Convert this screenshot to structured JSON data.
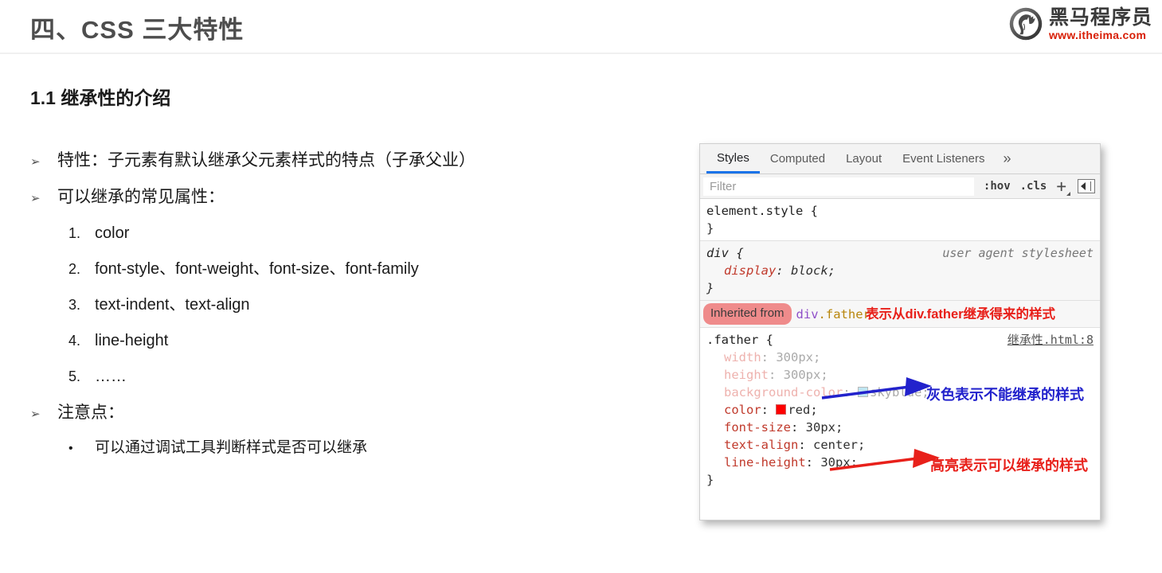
{
  "header": {
    "title": "四、CSS 三大特性",
    "logo": {
      "icon": "horse-head-circle-logo",
      "brand_cn": "黑马程序员",
      "url": "www.itheima.com",
      "url_color": "#d81e06"
    }
  },
  "section": {
    "heading": "1.1 继承性的介绍"
  },
  "bullets": [
    {
      "marker": "➢",
      "text": "特性：子元素有默认继承父元素样式的特点（子承父业）"
    },
    {
      "marker": "➢",
      "text": "可以继承的常见属性："
    }
  ],
  "numbered": [
    {
      "marker": "1.",
      "text": "color"
    },
    {
      "marker": "2.",
      "text": "font-style、font-weight、font-size、font-family"
    },
    {
      "marker": "3.",
      "text": "text-indent、text-align"
    },
    {
      "marker": "4.",
      "text": "line-height"
    },
    {
      "marker": "5.",
      "text": "……"
    }
  ],
  "note": {
    "marker": "➢",
    "title": "注意点：",
    "sub_marker": "•",
    "sub_text": "可以通过调试工具判断样式是否可以继承"
  },
  "devtools": {
    "tabs": [
      {
        "label": "Styles",
        "active": true
      },
      {
        "label": "Computed",
        "active": false
      },
      {
        "label": "Layout",
        "active": false
      },
      {
        "label": "Event Listeners",
        "active": false
      }
    ],
    "more_tabs_icon": "»",
    "filter": {
      "placeholder": "Filter",
      "value": ""
    },
    "toolbar": {
      "hov": ":hov",
      "cls": ".cls",
      "new_rule_icon": "plus-icon",
      "sidebar_toggle_icon": "panel-toggle-icon"
    },
    "rules": [
      {
        "selector": "element.style {",
        "origin": "",
        "close": "}",
        "declarations": []
      },
      {
        "selector": "div {",
        "origin": "user agent stylesheet",
        "close": "}",
        "declarations": [
          {
            "prop": "display",
            "value": "block;",
            "dim": false,
            "swatch": null
          }
        ]
      }
    ],
    "inherited": {
      "pill": "Inherited from",
      "tag": "div",
      "cls": ".father"
    },
    "father_rule": {
      "selector": ".father {",
      "source": "继承性.html:8",
      "close": "}",
      "declarations": [
        {
          "prop": "width",
          "value": "300px;",
          "dim": true,
          "swatch": null
        },
        {
          "prop": "height",
          "value": "300px;",
          "dim": true,
          "swatch": null
        },
        {
          "prop": "background-color",
          "value": "skyblue;",
          "dim": true,
          "swatch": "#bfe6f2"
        },
        {
          "prop": "color",
          "value": "red;",
          "dim": false,
          "swatch": "#ff0000"
        },
        {
          "prop": "font-size",
          "value": "30px;",
          "dim": false,
          "swatch": null
        },
        {
          "prop": "text-align",
          "value": "center;",
          "dim": false,
          "swatch": null
        },
        {
          "prop": "line-height",
          "value": "30px;",
          "dim": false,
          "swatch": null
        }
      ]
    }
  },
  "annotations": [
    {
      "id": "inherit-note",
      "text": "表示从div.father继承得来的样式",
      "color": "#e8201a"
    },
    {
      "id": "gray-note",
      "text": "灰色表示不能继承的样式",
      "color": "#2222cc"
    },
    {
      "id": "highlight-note",
      "text": "高亮表示可以继承的样式",
      "color": "#e8201a"
    }
  ]
}
